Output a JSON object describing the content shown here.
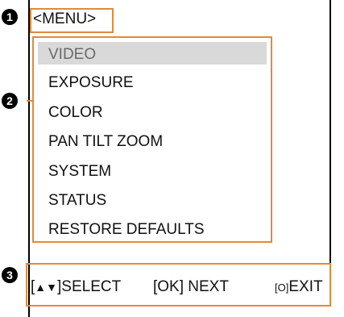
{
  "callouts": [
    "1",
    "2",
    "3"
  ],
  "menu": {
    "title": "<MENU>",
    "items": [
      {
        "label": "VIDEO",
        "selected": true
      },
      {
        "label": "EXPOSURE",
        "selected": false
      },
      {
        "label": "COLOR",
        "selected": false
      },
      {
        "label": "PAN TILT ZOOM",
        "selected": false
      },
      {
        "label": "SYSTEM",
        "selected": false
      },
      {
        "label": "STATUS",
        "selected": false
      },
      {
        "label": "RESTORE DEFAULTS",
        "selected": false
      }
    ]
  },
  "footer": {
    "select": {
      "arrows": "▲▼",
      "prefix": "[",
      "suffix": "]SELECT"
    },
    "next": "[OK] NEXT",
    "exit": {
      "key": "[O]",
      "label": "EXIT"
    }
  },
  "colors": {
    "annotation": "#e3893a",
    "highlight": "#d9d9d9",
    "callout": "#000000"
  }
}
